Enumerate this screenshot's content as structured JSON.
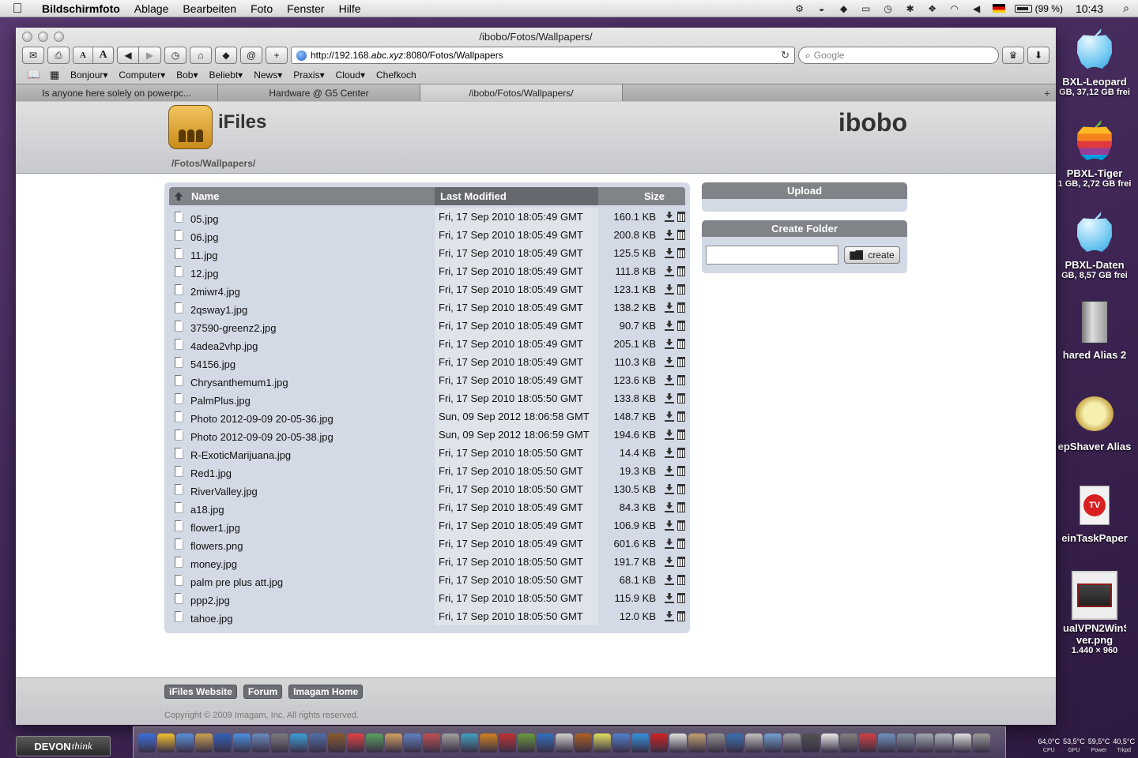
{
  "menubar": {
    "app": "Bildschirmfoto",
    "menus": [
      "Ablage",
      "Bearbeiten",
      "Foto",
      "Fenster",
      "Hilfe"
    ],
    "battery": "(99 %)",
    "clock": "10:43"
  },
  "browser": {
    "title": "/ibobo/Fotos/Wallpapers/",
    "url_prefix": "http://192.168.",
    "url_host_italic": "abc.xyz",
    "url_suffix": ":8080/Fotos/Wallpapers",
    "search_placeholder": "Google",
    "bookmarks": [
      "Bonjour▾",
      "Computer▾",
      "Bob▾",
      "Beliebt▾",
      "News▾",
      "Praxis▾",
      "Cloud▾",
      "Chefkoch"
    ],
    "tabs": [
      {
        "label": "Is anyone here solely on powerpc..."
      },
      {
        "label": "Hardware @ G5 Center"
      },
      {
        "label": "/ibobo/Fotos/Wallpapers/"
      }
    ]
  },
  "page": {
    "app_name": "iFiles",
    "user": "ibobo",
    "path": "/Fotos/Wallpapers/",
    "columns": {
      "name": "Name",
      "modified": "Last Modified",
      "size": "Size"
    },
    "files": [
      {
        "name": "05.jpg",
        "modified": "Fri, 17 Sep 2010 18:05:49 GMT",
        "size": "160.1 KB"
      },
      {
        "name": "06.jpg",
        "modified": "Fri, 17 Sep 2010 18:05:49 GMT",
        "size": "200.8 KB"
      },
      {
        "name": "11.jpg",
        "modified": "Fri, 17 Sep 2010 18:05:49 GMT",
        "size": "125.5 KB"
      },
      {
        "name": "12.jpg",
        "modified": "Fri, 17 Sep 2010 18:05:49 GMT",
        "size": "111.8 KB"
      },
      {
        "name": "2miwr4.jpg",
        "modified": "Fri, 17 Sep 2010 18:05:49 GMT",
        "size": "123.1 KB"
      },
      {
        "name": "2qsway1.jpg",
        "modified": "Fri, 17 Sep 2010 18:05:49 GMT",
        "size": "138.2 KB"
      },
      {
        "name": "37590-greenz2.jpg",
        "modified": "Fri, 17 Sep 2010 18:05:49 GMT",
        "size": "90.7 KB"
      },
      {
        "name": "4adea2vhp.jpg",
        "modified": "Fri, 17 Sep 2010 18:05:49 GMT",
        "size": "205.1 KB"
      },
      {
        "name": "54156.jpg",
        "modified": "Fri, 17 Sep 2010 18:05:49 GMT",
        "size": "110.3 KB"
      },
      {
        "name": "Chrysanthemum1.jpg",
        "modified": "Fri, 17 Sep 2010 18:05:49 GMT",
        "size": "123.6 KB"
      },
      {
        "name": "PalmPlus.jpg",
        "modified": "Fri, 17 Sep 2010 18:05:50 GMT",
        "size": "133.8 KB"
      },
      {
        "name": "Photo 2012-09-09 20-05-36.jpg",
        "modified": "Sun, 09 Sep 2012 18:06:58 GMT",
        "size": "148.7 KB"
      },
      {
        "name": "Photo 2012-09-09 20-05-38.jpg",
        "modified": "Sun, 09 Sep 2012 18:06:59 GMT",
        "size": "194.6 KB"
      },
      {
        "name": "R-ExoticMarijuana.jpg",
        "modified": "Fri, 17 Sep 2010 18:05:50 GMT",
        "size": "14.4 KB"
      },
      {
        "name": "Red1.jpg",
        "modified": "Fri, 17 Sep 2010 18:05:50 GMT",
        "size": "19.3 KB"
      },
      {
        "name": "RiverValley.jpg",
        "modified": "Fri, 17 Sep 2010 18:05:50 GMT",
        "size": "130.5 KB"
      },
      {
        "name": "a18.jpg",
        "modified": "Fri, 17 Sep 2010 18:05:49 GMT",
        "size": "84.3 KB"
      },
      {
        "name": "flower1.jpg",
        "modified": "Fri, 17 Sep 2010 18:05:49 GMT",
        "size": "106.9 KB"
      },
      {
        "name": "flowers.png",
        "modified": "Fri, 17 Sep 2010 18:05:49 GMT",
        "size": "601.6 KB"
      },
      {
        "name": "money.jpg",
        "modified": "Fri, 17 Sep 2010 18:05:50 GMT",
        "size": "191.7 KB"
      },
      {
        "name": "palm pre plus att.jpg",
        "modified": "Fri, 17 Sep 2010 18:05:50 GMT",
        "size": "68.1 KB"
      },
      {
        "name": "ppp2.jpg",
        "modified": "Fri, 17 Sep 2010 18:05:50 GMT",
        "size": "115.9 KB"
      },
      {
        "name": "tahoe.jpg",
        "modified": "Fri, 17 Sep 2010 18:05:50 GMT",
        "size": "12.0 KB"
      }
    ],
    "upload_title": "Upload",
    "create_folder_title": "Create Folder",
    "create_button": "create",
    "footer_links": [
      "iFiles Website",
      "Forum",
      "Imagam Home"
    ],
    "copyright": "Copyright © 2009 Imagam, Inc. All rights reserved."
  },
  "desktop": [
    {
      "label": "BXL-Leopard",
      "sub": "GB, 37,12 GB frei",
      "icon": "apple-drive-icon"
    },
    {
      "label": "PBXL-Tiger",
      "sub": "1 GB, 2,72 GB frei",
      "icon": "apple-rainbow-drive-icon"
    },
    {
      "label": "PBXL-Daten",
      "sub": "GB, 8,57 GB frei",
      "icon": "apple-drive-icon"
    },
    {
      "label": "hared Alias 2",
      "sub": "",
      "icon": "server-icon"
    },
    {
      "label": "epShaver Alias",
      "sub": "",
      "icon": "sheep-icon"
    },
    {
      "label": "einTaskPaper",
      "sub": "",
      "icon": "document-icon"
    },
    {
      "label": "ualVPN2WinSer ver.png",
      "sub": "1.440 × 960",
      "icon": "image-thumbnail-icon"
    }
  ],
  "devon": {
    "part1": "DEVON",
    "part2": "think"
  },
  "temps": [
    {
      "value": "64,0°C",
      "label": "CPU"
    },
    {
      "value": "53,5°C",
      "label": "GPU"
    },
    {
      "value": "59,5°C",
      "label": "Power"
    },
    {
      "value": "40,5°C",
      "label": "Trkpd"
    }
  ]
}
